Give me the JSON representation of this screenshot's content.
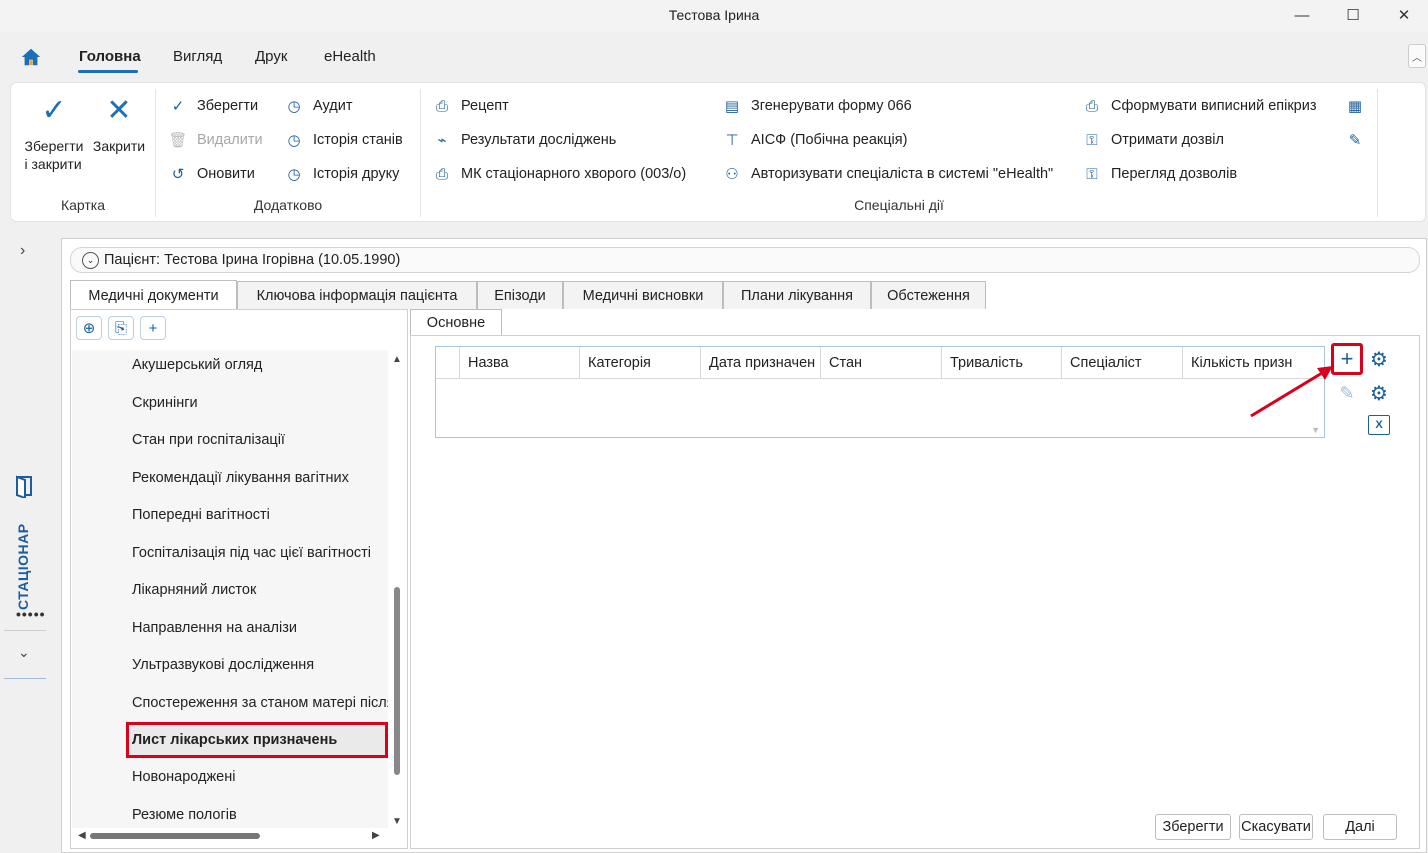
{
  "window": {
    "title": "Тестова Ірина",
    "minimize": "—",
    "maximize": "☐",
    "close": "✕"
  },
  "menu": {
    "items": [
      "Головна",
      "Вигляд",
      "Друк",
      "eHealth"
    ],
    "active": "Головна",
    "collapse_glyph": "︿"
  },
  "ribbon": {
    "groups": {
      "card": {
        "label": "Картка",
        "save_close": "Зберегти\nі закрити",
        "close": "Закрити"
      },
      "extra": {
        "label": "Додатково",
        "save": "Зберегти",
        "delete": "Видалити",
        "refresh": "Оновити",
        "audit": "Аудит",
        "state_history": "Історія станів",
        "print_history": "Історія друку"
      },
      "special": {
        "label": "Спеціальні дії",
        "recipe": "Рецепт",
        "research_results": "Результати досліджень",
        "mk_inpatient": "МК стаціонарного хворого (003/о)",
        "generate_066": "Згенерувати форму 066",
        "aisf": "АІСФ (Побічна реакція)",
        "authorize": "Авторизувати спеціаліста в системі \"eHealth\"",
        "discharge": "Сформувати виписний епікриз",
        "get_permission": "Отримати дозвіл",
        "view_permissions": "Перегляд дозволів"
      }
    }
  },
  "left_strip": {
    "label": "СТАЦІОНАР",
    "dots": "•••••"
  },
  "patient": {
    "summary": "Пацієнт: Тестова Ірина Ігорівна (10.05.1990)"
  },
  "tabs": [
    {
      "label": "Медичні документи",
      "active": true
    },
    {
      "label": "Ключова інформація пацієнта",
      "active": false
    },
    {
      "label": "Епізоди",
      "active": false
    },
    {
      "label": "Медичні висновки",
      "active": false
    },
    {
      "label": "Плани лікування",
      "active": false
    },
    {
      "label": "Обстеження",
      "active": false
    }
  ],
  "documents": {
    "items": [
      "Акушерський огляд",
      "Скринінги",
      "Стан при госпіталізації",
      "Рекомендації лікування вагітних",
      "Попередні вагітності",
      "Госпіталізація під час цієї вагітності",
      "Лікарняний листок",
      "Направлення на аналізи",
      "Ультразвукові дослідження",
      "Спостереження за станом матері після",
      "Лист лікарських призначень",
      "Новонароджені",
      "Резюме пологів"
    ],
    "selected": "Лист лікарських призначень"
  },
  "subtab": {
    "label": "Основне"
  },
  "grid": {
    "columns": [
      "",
      "Назва",
      "Категорія",
      "Дата призначен",
      "Стан",
      "Тривалість",
      "Спеціаліст",
      "Кількість призн"
    ]
  },
  "footer": {
    "save": "Зберегти",
    "cancel": "Скасувати",
    "next": "Далі"
  },
  "colors": {
    "accent": "#1a6fb8",
    "highlight": "#d9001b"
  }
}
